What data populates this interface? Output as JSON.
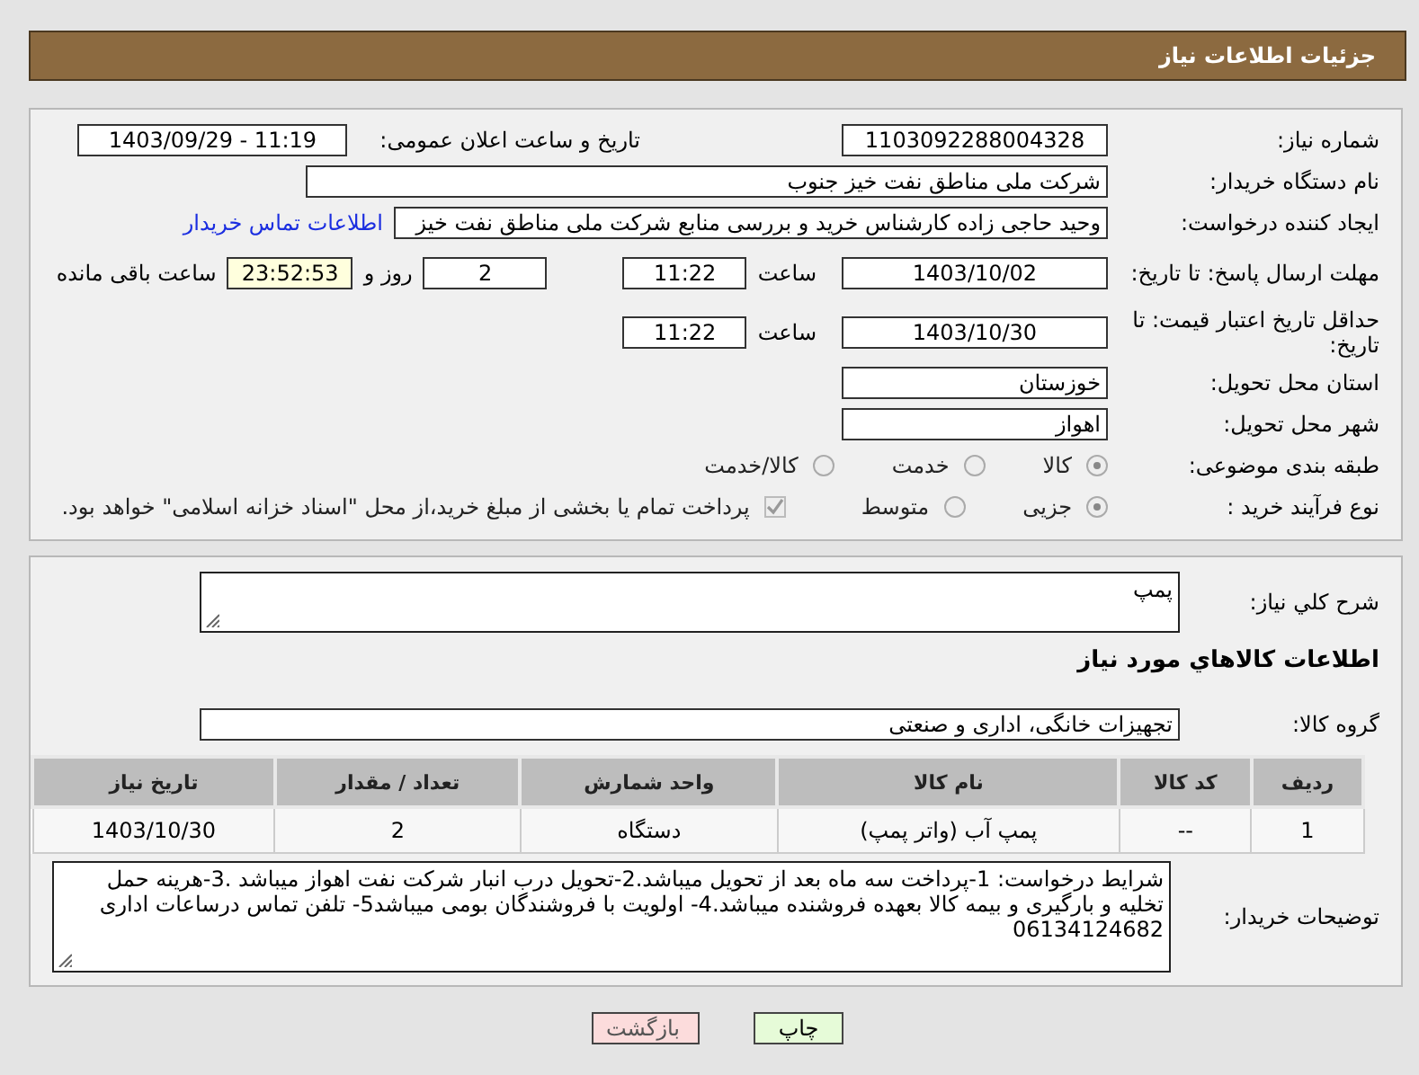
{
  "header": {
    "title": "جزئیات اطلاعات نیاز"
  },
  "need_number": {
    "label": "شماره نیاز:",
    "value": "1103092288004328"
  },
  "announce": {
    "label": "تاریخ و ساعت اعلان عمومی:",
    "value": "1403/09/29 - 11:19"
  },
  "buyer": {
    "label": "نام دستگاه خریدار:",
    "value": "شرکت ملی مناطق نفت خیز جنوب"
  },
  "requester": {
    "label": "ایجاد کننده درخواست:",
    "value": "وحید حاجی زاده  کارشناس خرید و بررسی منابع  شرکت ملی مناطق نفت خیز",
    "link": "اطلاعات تماس خریدار"
  },
  "reply_deadline": {
    "label": "مهلت ارسال پاسخ: تا تاریخ:",
    "date": "1403/10/02",
    "time_label": "ساعت",
    "time": "11:22",
    "days": "2",
    "days_label": "روز و",
    "remaining": "23:52:53",
    "remaining_label": "ساعت باقی مانده"
  },
  "price_validity": {
    "label": "حداقل تاریخ اعتبار قیمت: تا تاریخ:",
    "date": "1403/10/30",
    "time_label": "ساعت",
    "time": "11:22"
  },
  "province": {
    "label": "استان محل تحویل:",
    "value": "خوزستان"
  },
  "city": {
    "label": "شهر محل تحویل:",
    "value": "اهواز"
  },
  "category": {
    "label": "طبقه بندی موضوعی:",
    "options": [
      {
        "label": "کالا",
        "selected": true
      },
      {
        "label": "خدمت",
        "selected": false
      },
      {
        "label": "کالا/خدمت",
        "selected": false
      }
    ]
  },
  "process": {
    "label": "نوع فرآیند خرید :",
    "options": [
      {
        "label": "جزیی",
        "selected": true
      },
      {
        "label": "متوسط",
        "selected": false
      }
    ],
    "treasury": {
      "checked": true,
      "label": "پرداخت تمام یا بخشی از مبلغ خرید،از محل \"اسناد خزانه اسلامی\" خواهد بود."
    }
  },
  "description": {
    "label": "شرح کلي نیاز:",
    "value": "پمپ"
  },
  "goods_title": "اطلاعات کالاهاي مورد نیاز",
  "goods_group": {
    "label": "گروه کالا:",
    "value": "تجهیزات خانگی، اداری و صنعتی"
  },
  "table": {
    "columns": [
      "ردیف",
      "کد کالا",
      "نام کالا",
      "واحد شمارش",
      "تعداد / مقدار",
      "تاریخ نیاز"
    ],
    "rows": [
      [
        "1",
        "--",
        "پمپ آب (واتر پمپ)",
        "دستگاه",
        "2",
        "1403/10/30"
      ]
    ]
  },
  "buyer_notes": {
    "label": "توضیحات خریدار:",
    "value": "شرایط درخواست: 1-پرداخت سه ماه بعد از تحویل میباشد.2-تحویل درب انبار شرکت نفت اهواز میباشد .3-هرینه حمل تخلیه و بارگیری و بیمه کالا بعهده فروشنده میباشد.4-     اولویت با فروشندگان بومی میباشد5- تلفن تماس درساعات اداری 06134124682"
  },
  "buttons": [
    {
      "kind": "print",
      "label": "چاپ"
    },
    {
      "kind": "back",
      "label": "بازگشت"
    }
  ]
}
